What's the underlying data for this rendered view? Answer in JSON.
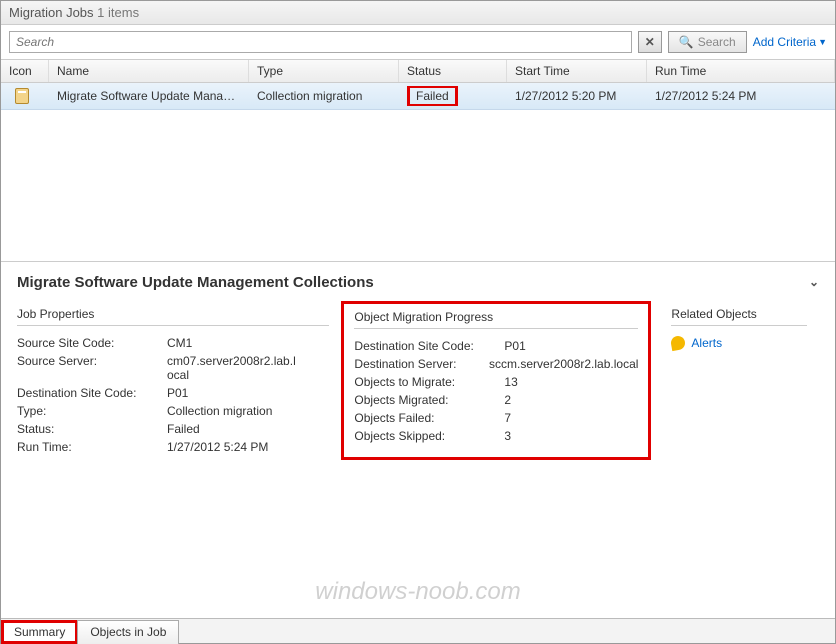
{
  "header": {
    "title": "Migration Jobs",
    "count": "1 items"
  },
  "search": {
    "placeholder": "Search",
    "search_label": "Search",
    "add_criteria": "Add Criteria"
  },
  "columns": {
    "icon": "Icon",
    "name": "Name",
    "type": "Type",
    "status": "Status",
    "start": "Start Time",
    "run": "Run Time"
  },
  "row": {
    "name": "Migrate Software Update Manageme...",
    "type": "Collection migration",
    "status": "Failed",
    "start": "1/27/2012 5:20 PM",
    "run": "1/27/2012 5:24 PM"
  },
  "details": {
    "title": "Migrate Software Update Management Collections",
    "job_properties": {
      "heading": "Job Properties",
      "items": [
        {
          "k": "Source Site Code:",
          "v": "CM1"
        },
        {
          "k": "Source Server:",
          "v": "cm07.server2008r2.lab.local"
        },
        {
          "k": "Destination Site Code:",
          "v": "P01"
        },
        {
          "k": "Type:",
          "v": "Collection migration"
        },
        {
          "k": "Status:",
          "v": "Failed"
        },
        {
          "k": "Run Time:",
          "v": "1/27/2012 5:24 PM"
        }
      ]
    },
    "progress": {
      "heading": "Object Migration Progress",
      "items": [
        {
          "k": "Destination Site Code:",
          "v": "P01"
        },
        {
          "k": "Destination Server:",
          "v": "sccm.server2008r2.lab.local"
        },
        {
          "k": "Objects to Migrate:",
          "v": "13"
        },
        {
          "k": "Objects Migrated:",
          "v": "2"
        },
        {
          "k": "Objects Failed:",
          "v": "7"
        },
        {
          "k": "Objects Skipped:",
          "v": "3"
        }
      ]
    },
    "related": {
      "heading": "Related Objects",
      "alerts": "Alerts"
    }
  },
  "tabs": {
    "summary": "Summary",
    "objects": "Objects in Job"
  },
  "watermark": "windows-noob.com"
}
